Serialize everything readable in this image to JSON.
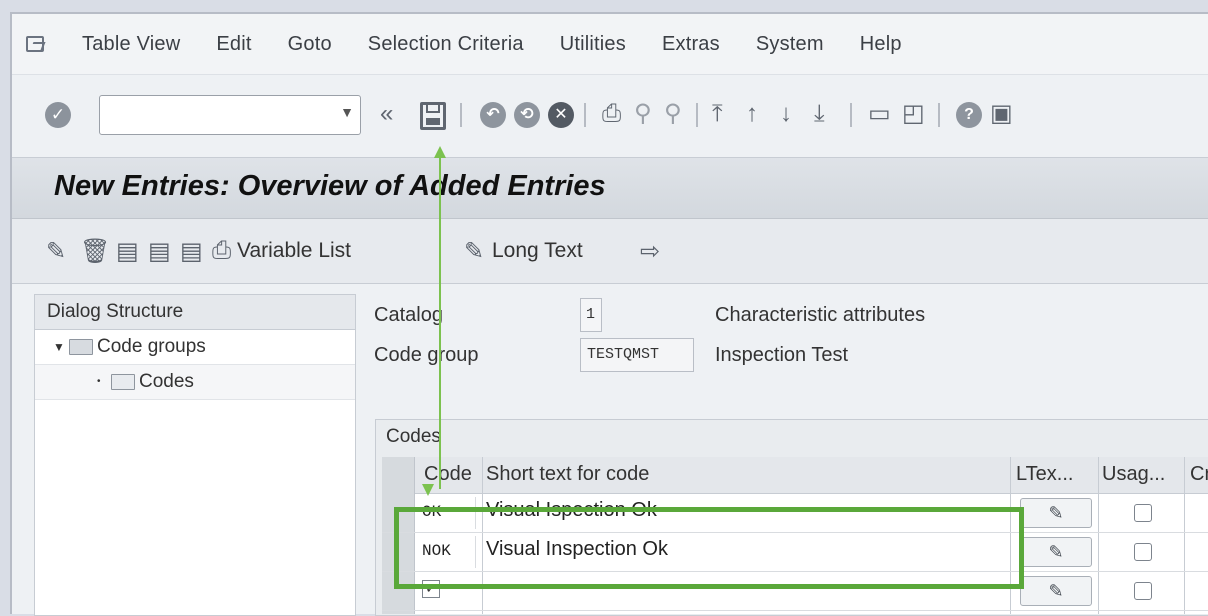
{
  "menu": {
    "items": [
      "Table View",
      "Edit",
      "Goto",
      "Selection Criteria",
      "Utilities",
      "Extras",
      "System",
      "Help"
    ]
  },
  "toolbar": {
    "command_value": "",
    "back_glyph": "«"
  },
  "title": "New Entries: Overview of Added Entries",
  "app_toolbar": {
    "variable_list": "Variable List",
    "long_text": "Long Text"
  },
  "dialog_structure": {
    "header": "Dialog Structure",
    "items": [
      {
        "label": "Code groups",
        "expanded": true
      },
      {
        "label": "Codes",
        "selected": true
      }
    ]
  },
  "header_fields": {
    "catalog_label": "Catalog",
    "catalog_value": "1",
    "catalog_desc": "Characteristic attributes",
    "code_group_label": "Code group",
    "code_group_value": "TESTQMST",
    "code_group_desc": "Inspection Test"
  },
  "codes_table": {
    "title": "Codes",
    "columns": [
      "Code",
      "Short text for code",
      "LTex...",
      "Usag...",
      "Cr"
    ],
    "rows": [
      {
        "code": "OK",
        "text": "Visual Ispection Ok"
      },
      {
        "code": "NOK",
        "text": "Visual Inspection Ok"
      },
      {
        "code": "",
        "text": ""
      }
    ]
  },
  "colors": {
    "highlight": "#5aa83a",
    "arrow": "#7cc24f"
  }
}
